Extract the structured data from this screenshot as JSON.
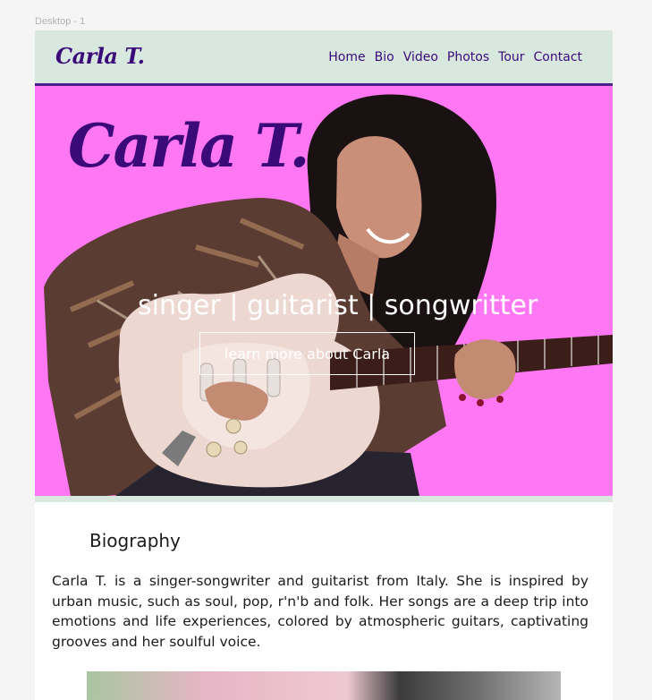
{
  "canvas": {
    "frame_label": "Desktop - 1"
  },
  "header": {
    "brand": "Carla T.",
    "nav": [
      {
        "label": "Home"
      },
      {
        "label": "Bio"
      },
      {
        "label": "Video"
      },
      {
        "label": "Photos"
      },
      {
        "label": "Tour"
      },
      {
        "label": "Contact"
      }
    ]
  },
  "hero": {
    "title": "Carla T.",
    "tagline": "singer | guitarist | songwritter",
    "button_label": "learn more about Carla"
  },
  "bio": {
    "heading": "Biography",
    "text": "Carla T. is a singer-songwriter and guitarist from Italy. She is inspired by urban music, such as soul, pop, r'n'b and folk. Her songs are a deep trip into emotions and life experiences, colored by atmospheric guitars, captivating grooves and her soulful voice."
  },
  "colors": {
    "header_bg": "#d9e8df",
    "accent_purple": "#3a0a78",
    "hero_bg": "#ff77f2"
  }
}
